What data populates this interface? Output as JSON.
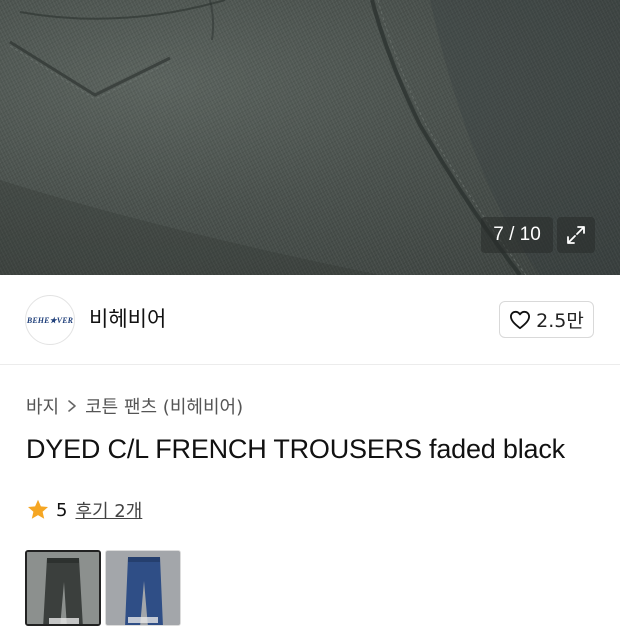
{
  "gallery": {
    "counter": "7 / 10",
    "expand_icon": "expand-icon"
  },
  "seller": {
    "avatar_text": "BEHE★VER",
    "name": "비헤비어"
  },
  "like": {
    "icon": "heart-outline-icon",
    "count": "2.5만"
  },
  "breadcrumb": {
    "items": [
      "바지",
      "코튼 팬츠 (비헤비어)"
    ]
  },
  "product": {
    "title": "DYED C/L FRENCH TROUSERS faded black"
  },
  "rating": {
    "icon": "star-icon",
    "star_color": "#f5a623",
    "value": "5",
    "review_label": "후기 2개"
  },
  "thumbnails": [
    {
      "variant": "faded black",
      "selected": true
    },
    {
      "variant": "blue",
      "selected": false
    }
  ]
}
